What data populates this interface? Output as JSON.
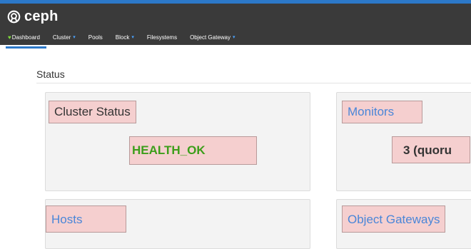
{
  "app": {
    "brand": "ceph"
  },
  "nav": {
    "items": [
      {
        "label": "Dashboard",
        "active": true
      },
      {
        "label": "Cluster",
        "dropdown": true
      },
      {
        "label": "Pools"
      },
      {
        "label": "Block",
        "dropdown": true
      },
      {
        "label": "Filesystems"
      },
      {
        "label": "Object Gateway",
        "dropdown": true
      }
    ]
  },
  "status": {
    "title": "Status",
    "cards": {
      "cluster_status": {
        "title": "Cluster Status",
        "value": "HEALTH_OK",
        "value_color": "#3c9e1a",
        "title_color": "#333333"
      },
      "monitors": {
        "title": "Monitors",
        "value": "3 (quoru",
        "title_color": "#4a86d8",
        "value_color": "#333333"
      },
      "hosts": {
        "title": "Hosts",
        "title_color": "#4a86d8"
      },
      "object_gateways": {
        "title": "Object Gateways",
        "title_color": "#4a86d8"
      }
    }
  },
  "colors": {
    "accent": "#2c78c8",
    "navbar": "#3a3a3a",
    "highlight": "#f5cfcf"
  }
}
